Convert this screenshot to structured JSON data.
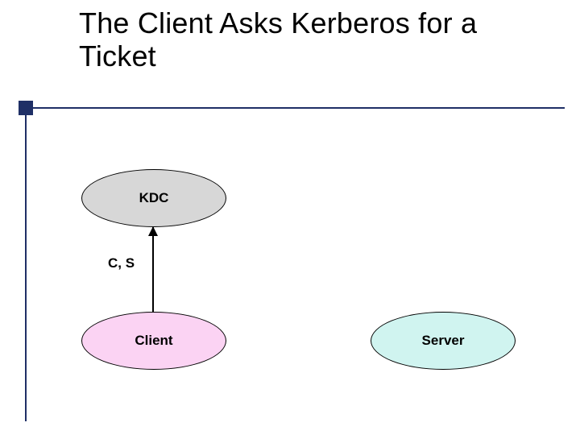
{
  "title": "The Client Asks Kerberos for a Ticket",
  "nodes": {
    "kdc": "KDC",
    "client": "Client",
    "server": "Server"
  },
  "arrow_label": "C, S",
  "colors": {
    "accent_navy": "#1f2f66",
    "kdc_fill": "#d7d7d7",
    "client_fill": "#fbd3f3",
    "server_fill": "#d0f4f0"
  }
}
